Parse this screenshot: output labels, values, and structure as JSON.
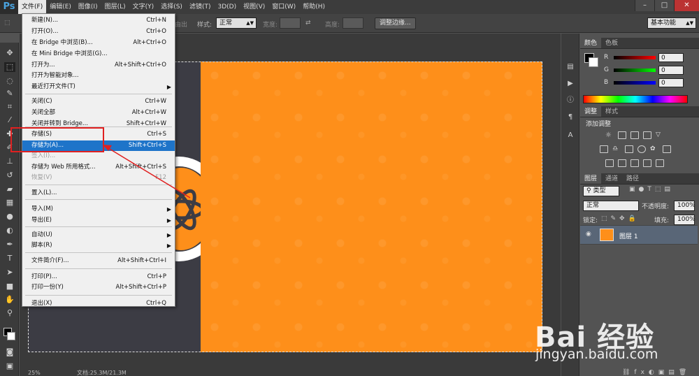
{
  "app": {
    "logo": "Ps"
  },
  "menubar": {
    "items": [
      "文件(F)",
      "编辑(E)",
      "图像(I)",
      "图层(L)",
      "文字(Y)",
      "选择(S)",
      "滤镜(T)",
      "3D(D)",
      "视图(V)",
      "窗口(W)",
      "帮助(H)"
    ],
    "active": "文件(F)"
  },
  "window_controls": {
    "minimize": "–",
    "maximize": "□",
    "close": "✕"
  },
  "optionsbar": {
    "style_label": "样式:",
    "style_value": "正常",
    "width_label": "宽度:",
    "height_label": "高度:",
    "refine_button": "调整边缘...",
    "workspace": "基本功能",
    "partial_label": "由出"
  },
  "file_menu": {
    "items": [
      {
        "label": "新建(N)...",
        "shortcut": "Ctrl+N"
      },
      {
        "label": "打开(O)...",
        "shortcut": "Ctrl+O"
      },
      {
        "label": "在 Bridge 中浏览(B)...",
        "shortcut": "Alt+Ctrl+O"
      },
      {
        "label": "在 Mini Bridge 中浏览(G)...",
        "shortcut": ""
      },
      {
        "label": "打开为...",
        "shortcut": "Alt+Shift+Ctrl+O"
      },
      {
        "label": "打开为智能对象...",
        "shortcut": ""
      },
      {
        "label": "最近打开文件(T)",
        "shortcut": "",
        "submenu": true
      },
      {
        "label": "关闭(C)",
        "shortcut": "Ctrl+W"
      },
      {
        "label": "关闭全部",
        "shortcut": "Alt+Ctrl+W"
      },
      {
        "label": "关闭并转到 Bridge...",
        "shortcut": "Shift+Ctrl+W"
      },
      {
        "label": "存储(S)",
        "shortcut": "Ctrl+S"
      },
      {
        "label": "存储为(A)...",
        "shortcut": "Shift+Ctrl+S",
        "highlight": true
      },
      {
        "label": "签入(I)...",
        "shortcut": "",
        "disabled": true
      },
      {
        "label": "存储为 Web 所用格式...",
        "shortcut": "Alt+Shift+Ctrl+S"
      },
      {
        "label": "恢复(V)",
        "shortcut": "F12",
        "disabled": true
      },
      {
        "label": "置入(L)...",
        "shortcut": ""
      },
      {
        "label": "导入(M)",
        "shortcut": "",
        "submenu": true
      },
      {
        "label": "导出(E)",
        "shortcut": "",
        "submenu": true
      },
      {
        "label": "自动(U)",
        "shortcut": "",
        "submenu": true
      },
      {
        "label": "脚本(R)",
        "shortcut": "",
        "submenu": true
      },
      {
        "label": "文件简介(F)...",
        "shortcut": "Alt+Shift+Ctrl+I"
      },
      {
        "label": "打印(P)...",
        "shortcut": "Ctrl+P"
      },
      {
        "label": "打印一份(Y)",
        "shortcut": "Alt+Shift+Ctrl+P"
      },
      {
        "label": "退出(X)",
        "shortcut": "Ctrl+Q"
      }
    ],
    "submenu_arrow": "▶"
  },
  "color_panel": {
    "tabs": [
      "颜色",
      "色板"
    ],
    "channels": [
      {
        "label": "R",
        "value": "0",
        "color": "#ff0000"
      },
      {
        "label": "G",
        "value": "0",
        "color": "#00ff00"
      },
      {
        "label": "B",
        "value": "0",
        "color": "#0000ff"
      }
    ]
  },
  "adjustments_panel": {
    "tabs": [
      "调整",
      "样式"
    ],
    "title": "添加调整"
  },
  "layers_panel": {
    "tabs": [
      "图层",
      "通道",
      "路径"
    ],
    "kind_filter": "类型",
    "blend_mode": "正常",
    "opacity_label": "不透明度:",
    "opacity_value": "100%",
    "lock_label": "锁定:",
    "fill_label": "填充:",
    "fill_value": "100%",
    "layers": [
      {
        "name": "图层 1",
        "visible": true,
        "thumb_color": "#fe8f1a"
      }
    ]
  },
  "status": {
    "zoom": "25%",
    "doc_info": "文档:25.3M/21.3M"
  },
  "watermark": {
    "logo": "Bai 经验",
    "url": "jingyan.baidu.com"
  },
  "colors": {
    "accent_orange": "#fe8f1a",
    "menu_highlight": "#1e74c9",
    "annotation_red": "#e02020"
  }
}
